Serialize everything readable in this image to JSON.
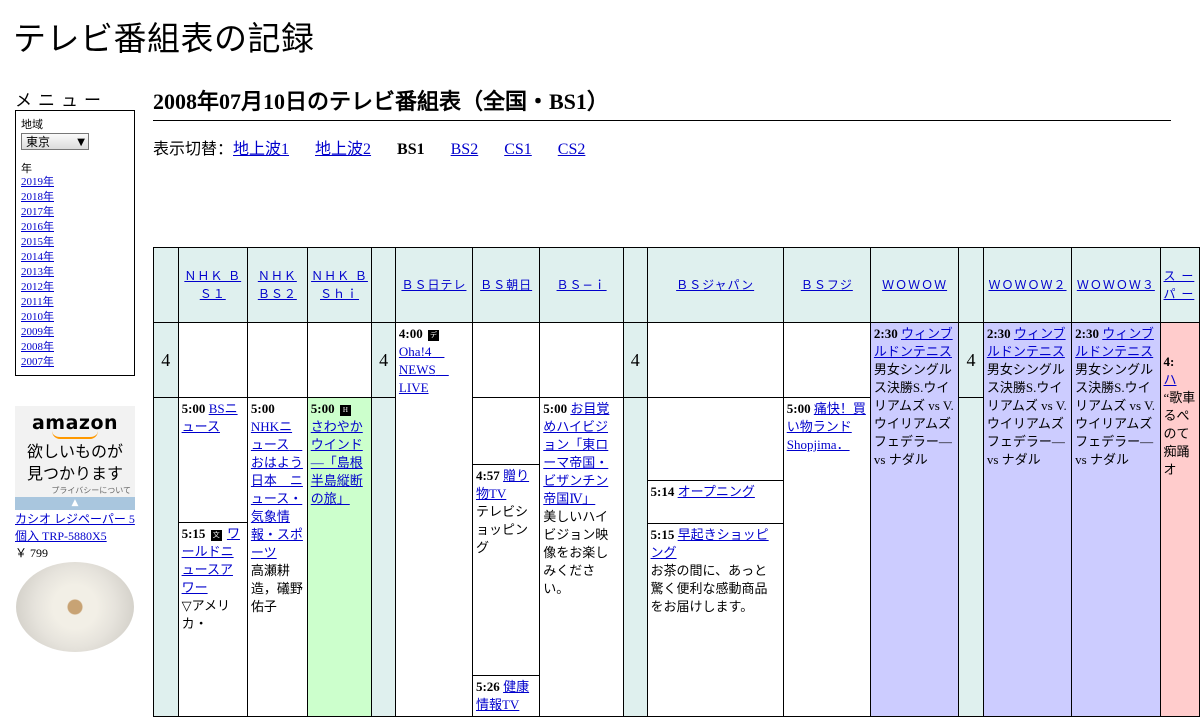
{
  "site_title": "テレビ番組表の記録",
  "menu": {
    "heading": "メニュー",
    "region_label": "地域",
    "region_value": "東京",
    "year_label": "年",
    "years": [
      "2019年",
      "2018年",
      "2017年",
      "2016年",
      "2015年",
      "2014年",
      "2013年",
      "2012年",
      "2011年",
      "2010年",
      "2009年",
      "2008年",
      "2007年"
    ]
  },
  "ad": {
    "logo": "amazon",
    "message_line1": "欲しいものが",
    "message_line2": "見つかります",
    "privacy": "プライバシーについて",
    "product_title": "カシオ レジペーパー 5個入 TRP-5880X5",
    "price": "￥ 799"
  },
  "page": {
    "heading": "2008年07月10日のテレビ番組表（全国・BS1）",
    "switch_label": "表示切替：",
    "tabs": [
      {
        "label": "地上波1",
        "link": true
      },
      {
        "label": "地上波2",
        "link": true
      },
      {
        "label": "BS1",
        "link": false
      },
      {
        "label": "BS2",
        "link": true
      },
      {
        "label": "CS1",
        "link": true
      },
      {
        "label": "CS2",
        "link": true
      }
    ]
  },
  "channels": {
    "nhkbs1": "ＮＨＫ ＢＳ１",
    "nhkbs2": "ＮＨＫ ＢＳ２",
    "nhkbshi": "ＮＨＫ ＢＳｈｉ",
    "bsntv": "ＢＳ日テレ",
    "bsasahi": "ＢＳ朝日",
    "bsi": "ＢＳ−ｉ",
    "bsjapan": "ＢＳジャパン",
    "bsfuji": "ＢＳフジ",
    "wowow": "ＷＯＷＯＷ",
    "wowow2": "ＷＯＷＯＷ２",
    "wowow3": "ＷＯＷＯＷ３",
    "partial": "ス ー パ ー"
  },
  "hour": "4",
  "programs": {
    "p_ntv_400": {
      "time": "4:00",
      "title": "Oha!4　NEWS　LIVE"
    },
    "p_wowow_230": {
      "time": "2:30",
      "title": "ウィンブルドンテニス",
      "desc": "男女シングルス決勝S.ウイリアムズ vs V.ウイリアムズ フェデラー― vs ナダル"
    },
    "p_wowow2_230": {
      "time": "2:30",
      "title": "ウィンブルドンテニス",
      "desc": "男女シングルス決勝S.ウイリアムズ vs V.ウイリアムズ フェデラー― vs ナダル"
    },
    "p_wowow3_230": {
      "time": "2:30",
      "title": "ウィンブルドンテニス",
      "desc": "男女シングルス決勝S.ウイリアムズ vs V.ウイリアムズ フェデラー― vs ナダル"
    },
    "p_partial_4": {
      "time": "4:",
      "title": "ハ",
      "desc": "“歌車るぺのて痴踊オ"
    },
    "p_asahi_457": {
      "time": "4:57",
      "title": "贈り物TV",
      "desc": "テレビショッピング"
    },
    "p_bs1_500": {
      "time": "5:00",
      "title": "BSニュース"
    },
    "p_bs2_500": {
      "time": "5:00",
      "title": "NHKニュース　おはよう日本　ニュース・気象情報・スポーツ",
      "desc": "高瀬耕造，礒野佑子"
    },
    "p_hi_500": {
      "time": "5:00",
      "title": "さわやかウインド―「島根半島縦断の旅」"
    },
    "p_bsi_500": {
      "time": "5:00",
      "title": "お目覚めハイビジョン「東ローマ帝国・ビザンチン帝国Ⅳ」",
      "desc": "美しいハイビジョン映像をお楽しみください。"
    },
    "p_fuji_500": {
      "time": "5:00",
      "title": "痛快！買い物ランド Shopjima．"
    },
    "p_japan_514": {
      "time": "5:14",
      "title": "オープニング"
    },
    "p_japan_515": {
      "time": "5:15",
      "title": "早起きショッピング",
      "desc": "お茶の間に、あっと驚く便利な感動商品をお届けします。"
    },
    "p_bs1_515": {
      "time": "5:15",
      "title": "ワールドニュースアワー",
      "desc": "▽アメリカ・"
    },
    "p_asahi_526": {
      "time": "5:26",
      "title": "健康情報TV"
    }
  }
}
